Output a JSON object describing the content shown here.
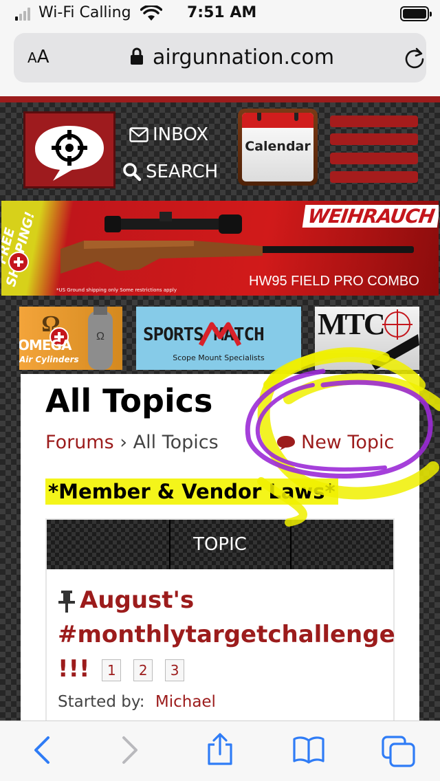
{
  "status_bar": {
    "carrier": "Wi-Fi Calling",
    "time": "7:51 AM"
  },
  "browser": {
    "text_size_label_small": "A",
    "text_size_label_large": "A",
    "url": "airgunnation.com"
  },
  "header": {
    "inbox_label": "INBOX",
    "search_label": "SEARCH",
    "calendar_label": "Calendar"
  },
  "banner": {
    "free_shipping": "FREE SHIPPING!",
    "brand": "WEIHRAUCH",
    "product": "HW95 FIELD PRO COMBO",
    "fine_print": "*US Ground shipping only  Some restrictions apply"
  },
  "sponsors": {
    "omega_name": "OMEGA",
    "omega_sub": "Air Cylinders",
    "sportsmatch_title": "SPORTS MATCH",
    "sportsmatch_sub": "Scope Mount Specialists",
    "mtc_title": "MTC"
  },
  "content": {
    "page_title": "All Topics",
    "breadcrumb_forums": "Forums",
    "breadcrumb_sep": "›",
    "breadcrumb_current": "All Topics",
    "new_topic": "New Topic",
    "laws": "*Member & Vendor Laws*",
    "table_header": "TOPIC",
    "topic_title_line1": "August's",
    "topic_title_line2": "#monthlytargetchallenge",
    "topic_title_line3": "!!!",
    "pages": [
      "1",
      "2",
      "3"
    ],
    "started_by_label": "Started by:",
    "author": "Michael"
  },
  "colors": {
    "site_red": "#9c1c1c",
    "law_highlight": "#f4f51a",
    "ios_blue": "#2f7cf6",
    "scribble_yellow": "#f0f000",
    "scribble_purple": "#9b2bd6"
  },
  "icons": [
    "signal-icon",
    "wifi-icon",
    "battery-icon",
    "lock-icon",
    "reload-icon",
    "envelope-icon",
    "search-icon",
    "calendar-icon",
    "hamburger-icon",
    "chat-bubble-icon",
    "pin-icon",
    "back-icon",
    "forward-icon",
    "share-icon",
    "bookmarks-icon",
    "tabs-icon"
  ]
}
